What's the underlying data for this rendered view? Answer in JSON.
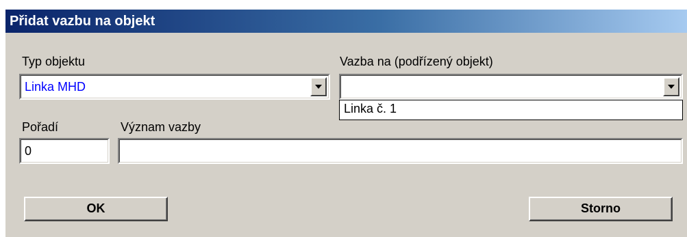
{
  "dialog": {
    "title": "Přidat vazbu na objekt"
  },
  "fields": {
    "type": {
      "label": "Typ objektu",
      "value": "Linka MHD",
      "value_color": "#0000ff"
    },
    "link": {
      "label": "Vazba na (podřízený objekt)",
      "value": "",
      "options": [
        "Linka č. 1"
      ]
    },
    "order": {
      "label": "Pořadí",
      "value": "0"
    },
    "meaning": {
      "label": "Význam vazby",
      "value": ""
    }
  },
  "buttons": {
    "ok_label": "OK",
    "cancel_label": "Storno"
  },
  "icons": {
    "dropdown": "chevron-down-icon"
  },
  "colors": {
    "title_gradient_start": "#0a246a",
    "title_gradient_end": "#a6caf0",
    "dialog_background": "#d4d0c8"
  }
}
